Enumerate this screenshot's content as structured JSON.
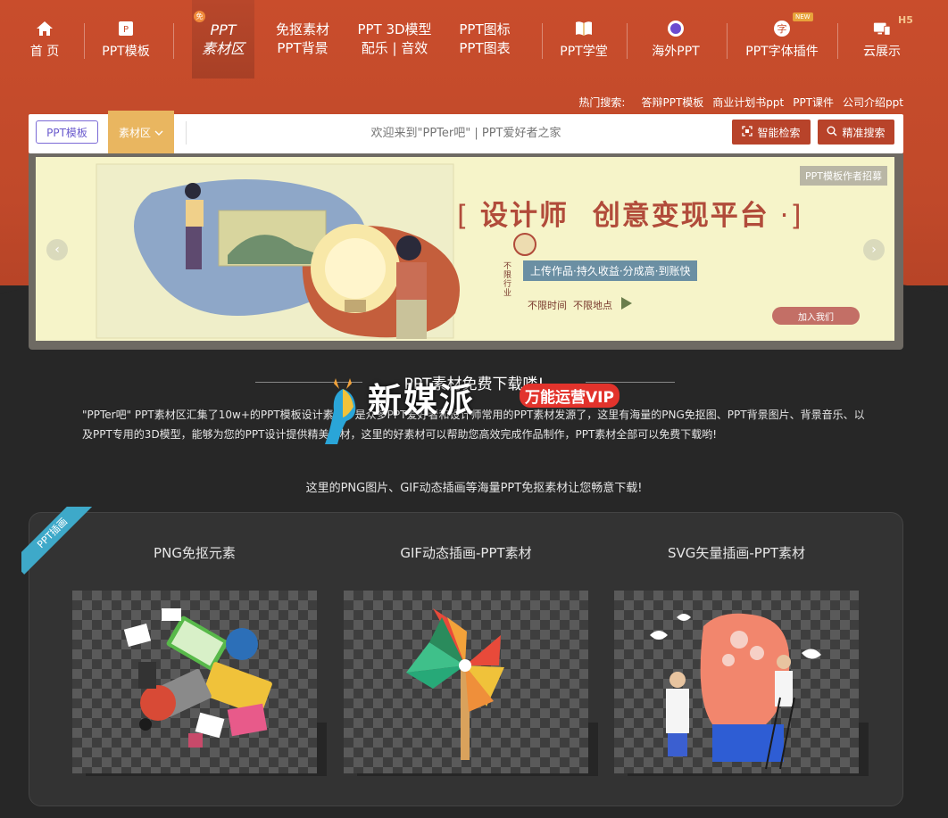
{
  "nav": {
    "items": [
      {
        "label": "首 页",
        "icon": "home-icon"
      },
      {
        "label": "PPT模板",
        "icon": "ppt-icon"
      },
      {
        "label_line1": "PPT",
        "label_line2": "素材区",
        "badge": "免"
      },
      {
        "label_line1": "免抠素材",
        "label_line2": "PPT背景"
      },
      {
        "label_line1": "PPT 3D模型",
        "label_line2": "配乐 | 音效"
      },
      {
        "label_line1": "PPT图标",
        "label_line2": "PPT图表"
      },
      {
        "label": "PPT学堂",
        "icon": "book-icon"
      },
      {
        "label": "海外PPT",
        "icon": "globe-icon"
      },
      {
        "label": "PPT字体插件",
        "icon": "font-plugin-icon",
        "badge": "NEW"
      },
      {
        "label": "云展示",
        "icon": "screen-icon",
        "badge": "H5"
      }
    ]
  },
  "hot_search": {
    "label": "热门搜索:",
    "items": [
      "答辩PPT模板",
      "商业计划书ppt",
      "PPT课件",
      "公司介绍ppt"
    ]
  },
  "search": {
    "tab_template": "PPT模板",
    "tab_material": "素材区",
    "placeholder": "欢迎来到\"PPTer吧\" | PPT爱好者之家",
    "btn_smart": "智能检索",
    "btn_precise": "精准搜索"
  },
  "banner": {
    "recruit_tag": "PPT模板作者招募",
    "title_left": "设计师",
    "title_right": "创意变现平台",
    "subtitle": "上传作品·持久收益·分成高·到账快",
    "vertical": "不限行业",
    "tag1": "不限时间",
    "tag2": "不限地点",
    "join": "加入我们"
  },
  "intro": {
    "title": "PPT素材免费下载喽!",
    "text": "\"PPTer吧\" PPT素材区汇集了10w+的PPT模板设计素材，是众多PPT爱好者和设计师常用的PPT素材发源了，这里有海量的PNG免抠图、PPT背景图片、背景音乐、以及PPT专用的3D模型，能够为您的PPT设计提供精美素材，这里的好素材可以帮助您高效完成作品制作，PPT素材全部可以免费下载哟!",
    "text2": "这里的PNG图片、GIF动态插画等海量PPT免抠素材让您畅意下载!"
  },
  "watermark": {
    "logo": "新媒派",
    "vip": "万能运营VIP"
  },
  "panel": {
    "ribbon": "PPT插画",
    "cards": [
      {
        "title": "PNG免抠元素"
      },
      {
        "title": "GIF动态插画-PPT素材"
      },
      {
        "title": "SVG矢量插画-PPT素材"
      }
    ]
  },
  "colors": {
    "brand": "#c94d2c",
    "accent_gold": "#e9b660",
    "button_red": "#b8432a",
    "ribbon_blue": "#3ea9c9"
  }
}
